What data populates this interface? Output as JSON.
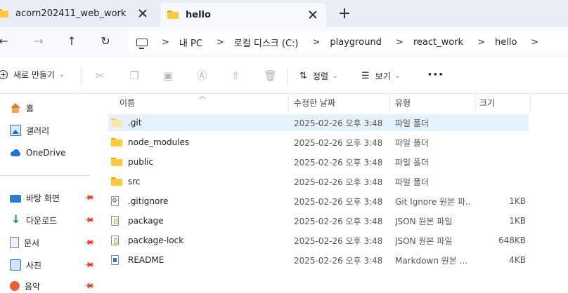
{
  "tabs": [
    {
      "label": "acorn202411_web_work",
      "active": false
    },
    {
      "label": "hello",
      "active": true
    }
  ],
  "nav": {
    "breadcrumb": [
      "내 PC",
      "로컬 디스크 (C:)",
      "playground",
      "react_work",
      "hello"
    ]
  },
  "commandbar": {
    "new_label": "새로 만들기",
    "sort_label": "정렬",
    "view_label": "보기",
    "more_label": "···"
  },
  "sidebar": {
    "top": [
      {
        "label": "홈",
        "icon": "home-icon"
      },
      {
        "label": "갤러리",
        "icon": "gallery-icon"
      },
      {
        "label": "OneDrive",
        "icon": "onedrive-icon"
      }
    ],
    "pinned": [
      {
        "label": "바탕 화면",
        "icon": "desktop-icon"
      },
      {
        "label": "다운로드",
        "icon": "download-icon"
      },
      {
        "label": "문서",
        "icon": "documents-icon"
      },
      {
        "label": "사진",
        "icon": "pictures-icon"
      },
      {
        "label": "음악",
        "icon": "music-icon"
      }
    ]
  },
  "columns": {
    "name": "이름",
    "date": "수정한 날짜",
    "type": "유형",
    "size": "크기"
  },
  "files": [
    {
      "name": ".git",
      "date": "2025-02-26 오후 3:48",
      "type": "파일 폴더",
      "size": "",
      "icon": "folder-icon",
      "selected": true
    },
    {
      "name": "node_modules",
      "date": "2025-02-26 오후 3:48",
      "type": "파일 폴더",
      "size": "",
      "icon": "folder-icon",
      "selected": false
    },
    {
      "name": "public",
      "date": "2025-02-26 오후 3:48",
      "type": "파일 폴더",
      "size": "",
      "icon": "folder-icon",
      "selected": false
    },
    {
      "name": "src",
      "date": "2025-02-26 오후 3:48",
      "type": "파일 폴더",
      "size": "",
      "icon": "folder-icon",
      "selected": false
    },
    {
      "name": ".gitignore",
      "date": "2025-02-26 오후 3:48",
      "type": "Git Ignore 원본 파...",
      "size": "1KB",
      "icon": "gear-file-icon",
      "selected": false
    },
    {
      "name": "package",
      "date": "2025-02-26 오후 3:48",
      "type": "JSON 원본 파일",
      "size": "1KB",
      "icon": "json-file-icon",
      "selected": false
    },
    {
      "name": "package-lock",
      "date": "2025-02-26 오후 3:48",
      "type": "JSON 원본 파일",
      "size": "648KB",
      "icon": "json-file-icon",
      "selected": false
    },
    {
      "name": "README",
      "date": "2025-02-26 오후 3:48",
      "type": "Markdown 원본 ...",
      "size": "4KB",
      "icon": "markdown-file-icon",
      "selected": false
    }
  ]
}
